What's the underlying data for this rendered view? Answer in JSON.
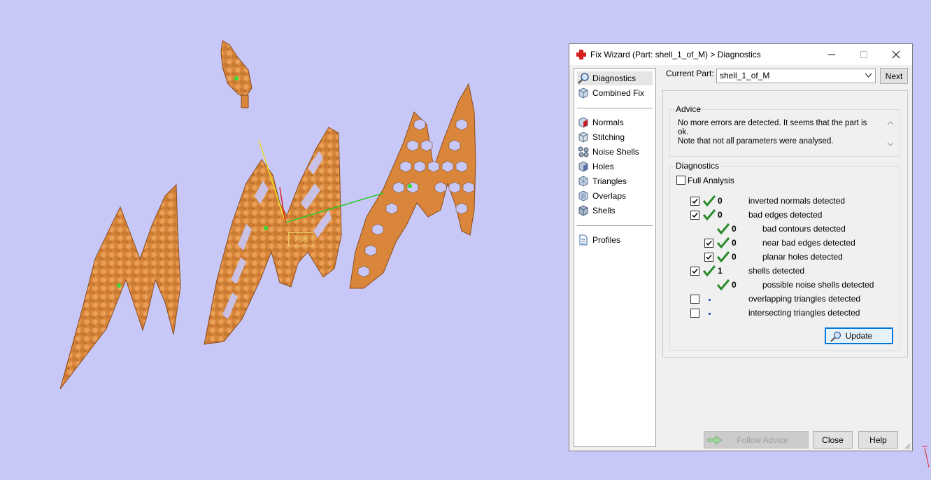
{
  "viewport": {
    "background_color": "#c8c8f8",
    "part_color": "#d9863a",
    "measure_label": "768"
  },
  "dialog": {
    "title": "Fix Wizard (Part: shell_1_of_M) > Diagnostics",
    "icons": {
      "app": "red-cross-icon",
      "minimize": "minimize-icon",
      "maximize": "maximize-icon",
      "close": "close-icon"
    },
    "nav": {
      "top": [
        {
          "label": "Diagnostics",
          "icon": "magnifier-icon",
          "selected": true
        },
        {
          "label": "Combined Fix",
          "icon": "cube-icon"
        }
      ],
      "fixes": [
        {
          "label": "Normals",
          "icon": "normals-icon"
        },
        {
          "label": "Stitching",
          "icon": "stitching-icon"
        },
        {
          "label": "Noise Shells",
          "icon": "noise-shells-icon"
        },
        {
          "label": "Holes",
          "icon": "holes-icon"
        },
        {
          "label": "Triangles",
          "icon": "triangles-icon"
        },
        {
          "label": "Overlaps",
          "icon": "overlaps-icon"
        },
        {
          "label": "Shells",
          "icon": "shells-icon"
        }
      ],
      "bottom": [
        {
          "label": "Profiles",
          "icon": "document-icon"
        }
      ]
    },
    "current_part_label": "Current Part:",
    "current_part_value": "shell_1_of_M",
    "next_label": "Next",
    "advice": {
      "title": "Advice",
      "line1": "No more errors are detected. It seems that the part is ok.",
      "line2": "Note that not all parameters were analysed."
    },
    "diagnostics": {
      "title": "Diagnostics",
      "full_analysis_label": "Full Analysis",
      "full_analysis_checked": false,
      "rows": [
        {
          "checkbox": true,
          "checked": true,
          "status": "ok",
          "count": "0",
          "label": "inverted normals detected",
          "indent": 0
        },
        {
          "checkbox": true,
          "checked": true,
          "status": "ok",
          "count": "0",
          "label": "bad edges detected",
          "indent": 0
        },
        {
          "checkbox": false,
          "checked": false,
          "status": "ok",
          "count": "0",
          "label": "bad contours detected",
          "indent": 1
        },
        {
          "checkbox": true,
          "checked": true,
          "status": "ok",
          "count": "0",
          "label": "near bad edges detected",
          "indent": 1
        },
        {
          "checkbox": true,
          "checked": true,
          "status": "ok",
          "count": "0",
          "label": "planar holes detected",
          "indent": 1
        },
        {
          "checkbox": true,
          "checked": true,
          "status": "ok",
          "count": "1",
          "label": "shells detected",
          "indent": 0
        },
        {
          "checkbox": false,
          "checked": false,
          "status": "ok",
          "count": "0",
          "label": "possible noise shells detected",
          "indent": 1
        },
        {
          "checkbox": true,
          "checked": false,
          "status": "unknown",
          "count": "",
          "label": "overlapping triangles detected",
          "indent": 0
        },
        {
          "checkbox": true,
          "checked": false,
          "status": "unknown",
          "count": "",
          "label": "intersecting triangles detected",
          "indent": 0
        }
      ],
      "update_label": "Update"
    },
    "footer": {
      "follow_advice_label": "Follow Advice",
      "close_label": "Close",
      "help_label": "Help"
    },
    "colors": {
      "ok_tick": "#2a8a2a",
      "focus_border": "#0078d7"
    }
  }
}
